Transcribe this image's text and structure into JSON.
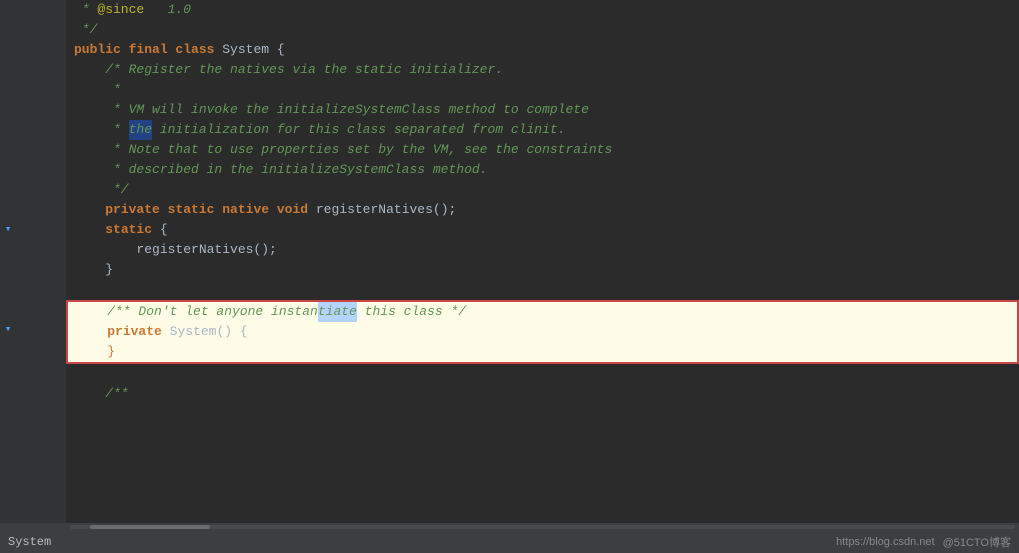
{
  "editor": {
    "background": "#2b2b2b",
    "lines": [
      {
        "number": "",
        "tokens": [
          {
            "text": " * ",
            "cls": "cm-block"
          },
          {
            "text": "@since",
            "cls": "annot"
          },
          {
            "text": "   1.0",
            "cls": "cm-block"
          }
        ],
        "fold": false,
        "margin": ""
      },
      {
        "number": "",
        "tokens": [
          {
            "text": " */",
            "cls": "cm-block"
          }
        ],
        "fold": false,
        "margin": ""
      },
      {
        "number": "",
        "tokens": [
          {
            "text": "public ",
            "cls": "kw"
          },
          {
            "text": "final ",
            "cls": "kw"
          },
          {
            "text": "class ",
            "cls": "kw"
          },
          {
            "text": "System {",
            "cls": "plain"
          }
        ],
        "fold": false,
        "margin": ""
      },
      {
        "number": "",
        "tokens": [
          {
            "text": "    /* Register the natives via the static initializer.",
            "cls": "cm-block"
          }
        ],
        "fold": false,
        "margin": ""
      },
      {
        "number": "",
        "tokens": [
          {
            "text": "     *",
            "cls": "cm-block"
          }
        ],
        "fold": false,
        "margin": ""
      },
      {
        "number": "",
        "tokens": [
          {
            "text": "     * VM will invoke the initializeSystemClass method to complete",
            "cls": "cm-block"
          }
        ],
        "fold": false,
        "margin": ""
      },
      {
        "number": "",
        "tokens": [
          {
            "text": "     * the initialization for this class separated from clinit.",
            "cls": "cm-block"
          }
        ],
        "fold": false,
        "margin": "the"
      },
      {
        "number": "",
        "tokens": [
          {
            "text": "     * Note that to use properties set by the VM, see the constraints",
            "cls": "cm-block"
          }
        ],
        "fold": false,
        "margin": ""
      },
      {
        "number": "",
        "tokens": [
          {
            "text": "     * described in the initializeSystemClass method.",
            "cls": "cm-block"
          }
        ],
        "fold": false,
        "margin": ""
      },
      {
        "number": "",
        "tokens": [
          {
            "text": "     */",
            "cls": "cm-block"
          }
        ],
        "fold": false,
        "margin": ""
      },
      {
        "number": "",
        "tokens": [
          {
            "text": "    ",
            "cls": "plain"
          },
          {
            "text": "private ",
            "cls": "kw"
          },
          {
            "text": "static ",
            "cls": "kw"
          },
          {
            "text": "native ",
            "cls": "kw"
          },
          {
            "text": "void ",
            "cls": "kw"
          },
          {
            "text": "registerNatives();",
            "cls": "plain"
          }
        ],
        "fold": false,
        "margin": ""
      },
      {
        "number": "",
        "tokens": [
          {
            "text": "    ",
            "cls": "plain"
          },
          {
            "text": "static",
            "cls": "kw"
          },
          {
            "text": " {",
            "cls": "plain"
          }
        ],
        "fold": true,
        "margin": ""
      },
      {
        "number": "",
        "tokens": [
          {
            "text": "        registerNatives();",
            "cls": "plain"
          }
        ],
        "fold": false,
        "margin": ""
      },
      {
        "number": "",
        "tokens": [
          {
            "text": "    }",
            "cls": "plain"
          }
        ],
        "fold": false,
        "margin": ""
      },
      {
        "number": "",
        "tokens": [],
        "fold": false,
        "margin": "",
        "empty": true
      },
      {
        "number": "",
        "tokens": [
          {
            "text": "    /** Don't let anyone instantiate this class */",
            "cls": "cm-block"
          }
        ],
        "fold": false,
        "margin": "",
        "highlighted": true,
        "blockStart": true
      },
      {
        "number": "",
        "tokens": [
          {
            "text": "    ",
            "cls": "plain"
          },
          {
            "text": "private ",
            "cls": "kw"
          },
          {
            "text": "System() {",
            "cls": "plain"
          }
        ],
        "fold": false,
        "margin": "",
        "highlighted": true
      },
      {
        "number": "",
        "tokens": [
          {
            "text": "    }",
            "cls": "plain"
          }
        ],
        "fold": false,
        "margin": "",
        "highlighted": true,
        "blockEnd": true
      },
      {
        "number": "",
        "tokens": [],
        "fold": false,
        "margin": "",
        "empty": true
      },
      {
        "number": "",
        "tokens": [
          {
            "text": "    /**",
            "cls": "cm-block"
          }
        ],
        "fold": false,
        "margin": ""
      }
    ],
    "bottom_bar": {
      "left_items": [
        "System"
      ],
      "right_items": [
        "https://blog.csdn.net",
        "@51CTO博客"
      ]
    }
  }
}
